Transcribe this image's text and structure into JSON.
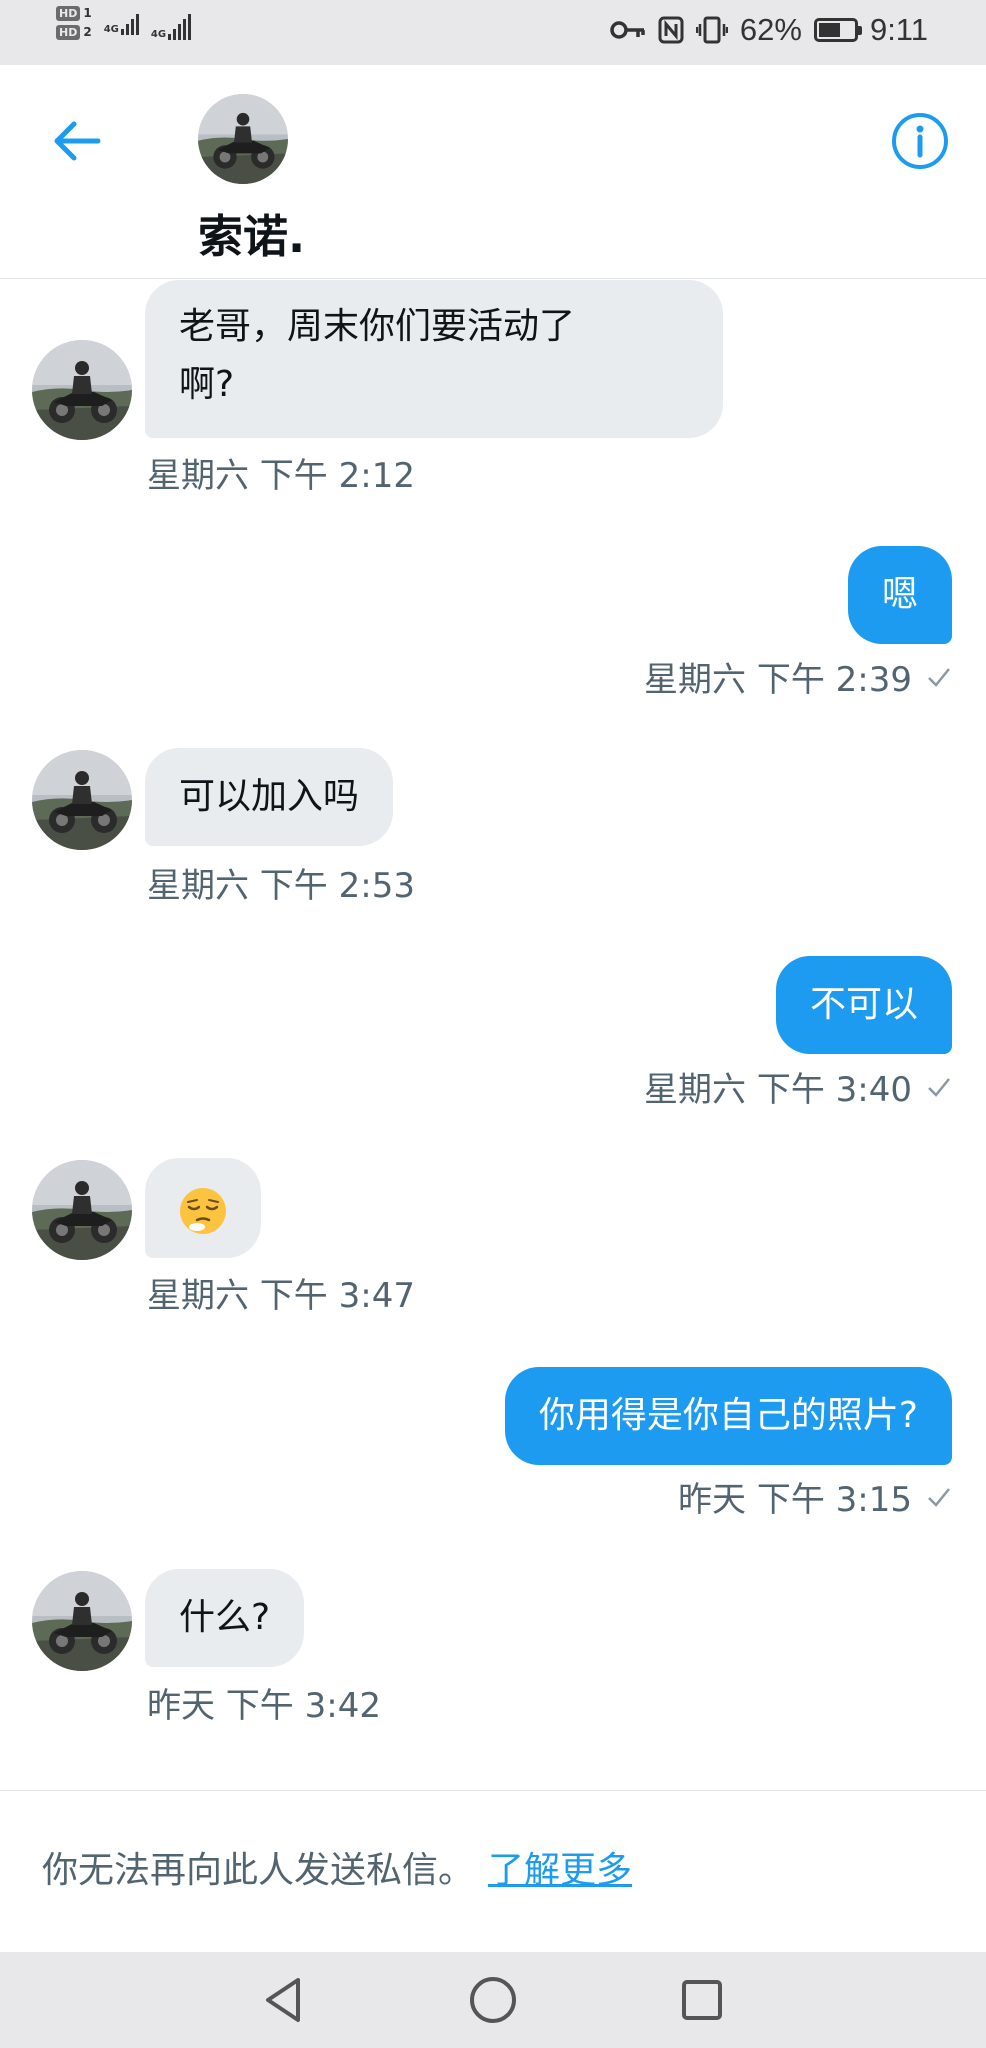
{
  "status_bar": {
    "sim1": "HD",
    "sim1_num": "1",
    "sim2": "HD",
    "sim2_num": "2",
    "network1": "4G",
    "network2": "4G",
    "battery_percent": "62%",
    "battery_level": 0.62,
    "time": "9:11",
    "icons": [
      "key-icon",
      "nfc-icon",
      "vibrate-icon",
      "battery-icon"
    ]
  },
  "header": {
    "contact_name": "索诺.",
    "back_icon": "arrow-left-icon",
    "info_icon": "info-icon"
  },
  "messages": [
    {
      "direction": "in",
      "text": "老哥，周末你们要活动了啊?",
      "line1": "老哥，周末你们要活动了",
      "line2": "啊?",
      "time": "星期六 下午 2:12"
    },
    {
      "direction": "out",
      "text": "嗯",
      "time": "星期六 下午 2:39"
    },
    {
      "direction": "in",
      "text": "可以加入吗",
      "time": "星期六 下午 2:53"
    },
    {
      "direction": "out",
      "text": "不可以",
      "time": "星期六 下午 3:40"
    },
    {
      "direction": "in",
      "text": "",
      "emoji": "relieved-face-emoji",
      "time": "星期六 下午 3:47"
    },
    {
      "direction": "out",
      "text": "你用得是你自己的照片?",
      "time": "昨天 下午 3:15"
    },
    {
      "direction": "in",
      "text": "什么?",
      "time": "昨天 下午 3:42"
    }
  ],
  "footer": {
    "notice": "你无法再向此人发送私信。",
    "link": "了解更多"
  },
  "nav_bar": {
    "icons": [
      "back-triangle-icon",
      "home-circle-icon",
      "recents-square-icon"
    ]
  },
  "colors": {
    "accent": "#1d9bf0",
    "incoming_bubble": "#e9ecef",
    "timestamp": "#536471",
    "status_bar_bg": "#e8e8ea"
  }
}
